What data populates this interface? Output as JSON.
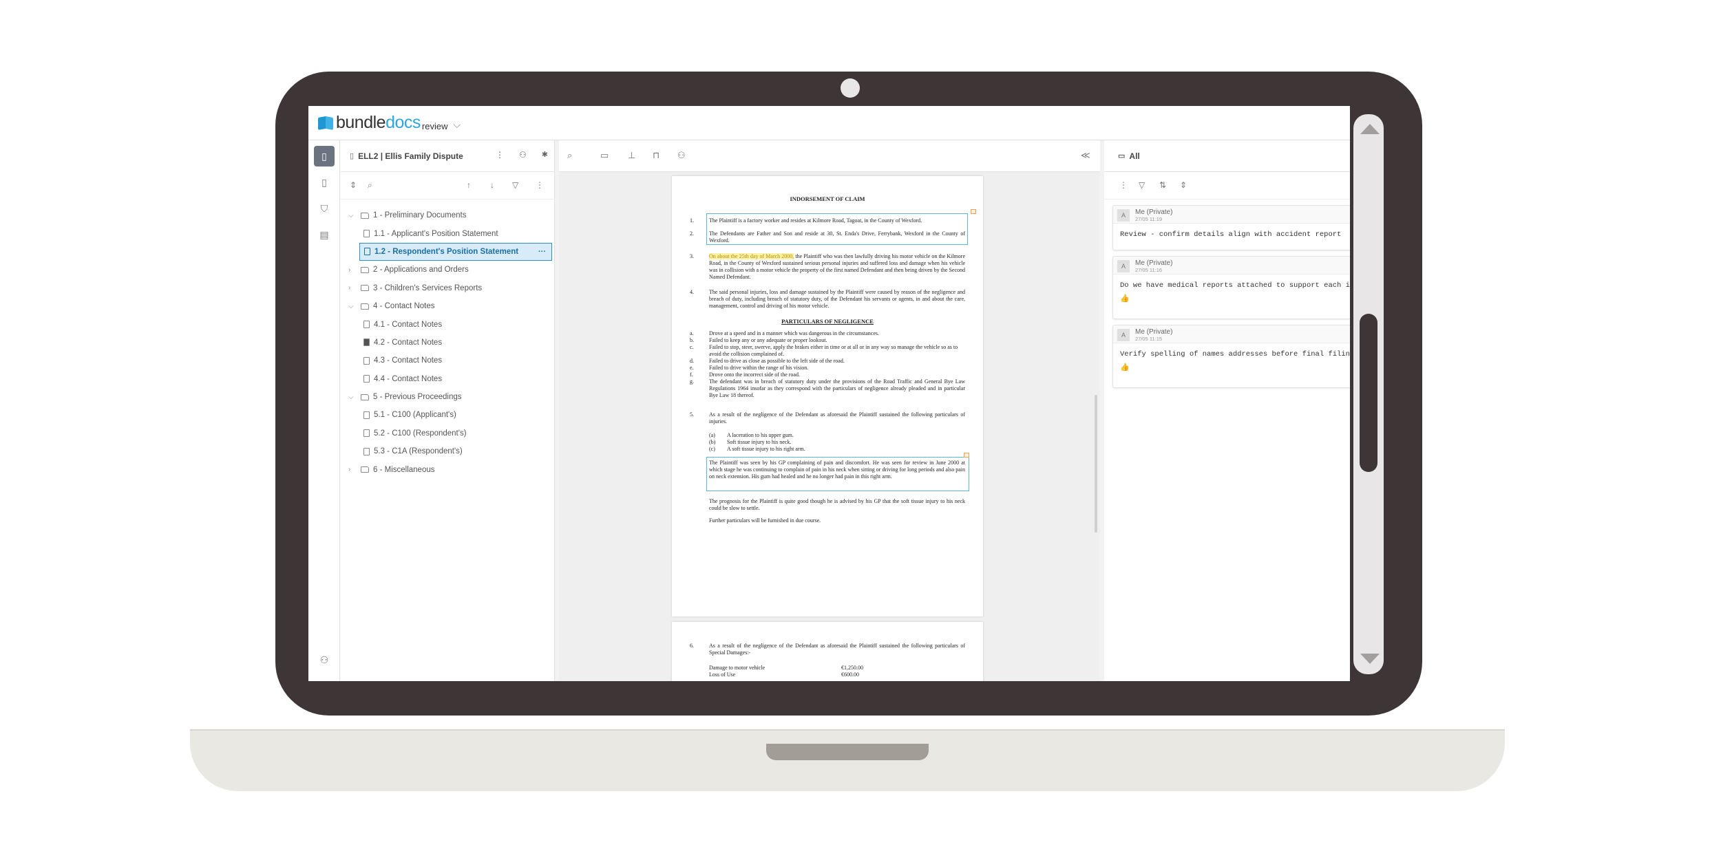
{
  "app": {
    "logo_bundle": "bundle",
    "logo_docs": "docs",
    "logo_review": "review"
  },
  "tree": {
    "title": "ELL2 | Ellis Family Dispute",
    "items": [
      {
        "label": "1 - Preliminary Documents",
        "type": "folder",
        "chevron": "⌵"
      },
      {
        "label": "1.1 - Applicant's Position Statement",
        "type": "doc"
      },
      {
        "label": "1.2 - Respondent's Position Statement",
        "type": "doc"
      },
      {
        "label": "2 - Applications and Orders",
        "type": "folder",
        "chevron": "›"
      },
      {
        "label": "3 - Children's Services Reports",
        "type": "folder",
        "chevron": "›"
      },
      {
        "label": "4 - Contact Notes",
        "type": "folder",
        "chevron": "⌵"
      },
      {
        "label": "4.1 - Contact Notes",
        "type": "doc"
      },
      {
        "label": "4.2 - Contact Notes",
        "type": "doc"
      },
      {
        "label": "4.3 - Contact Notes",
        "type": "doc"
      },
      {
        "label": "4.4 - Contact Notes",
        "type": "doc"
      },
      {
        "label": "5 - Previous Proceedings",
        "type": "folder",
        "chevron": "⌵"
      },
      {
        "label": "5.1 - C100 (Applicant's)",
        "type": "doc"
      },
      {
        "label": "5.2 - C100 (Respondent's)",
        "type": "doc"
      },
      {
        "label": "5.3 - C1A (Respondent's)",
        "type": "doc"
      },
      {
        "label": "6 - Miscellaneous",
        "type": "folder",
        "chevron": "›"
      }
    ],
    "more": "···"
  },
  "document": {
    "heading": "INDORSEMENT OF CLAIM",
    "p1_num": "1.",
    "p1": "The Plaintiff is a factory worker and resides at Kilmore Road, Tagoat, in the County of Wexford.",
    "p2_num": "2.",
    "p2": "The Defendants are Father and Son and reside at 30, St. Enda's Drive, Ferrybank, Wexford in the County of Wexford.",
    "p3_num": "3.",
    "p3_highlight": "On about the 25th day of March 2000,",
    "p3": " the Plaintiff who was then lawfully driving his motor vehicle on the Kilmore Road, in the County of Wexford sustained serious personal injuries and suffered loss and damage when his vehicle was in collision with a motor vehicle the property of the first named Defendant and then being driven by the Second Named Defendant.",
    "p4_num": "4.",
    "p4": "The said personal injuries, loss and damage sustained by the Plaintiff were caused by reason of the negligence and breach of duty, including breach of statutory duty, of the Defendant his servants or agents, in and about the care, management, control and driving of his motor vehicle.",
    "heading2": "PARTICULARS OF NEGLIGENCE",
    "neg_items": [
      {
        "k": "a.",
        "t": "Drove at a speed and in a manner which was dangerous in the circumstances."
      },
      {
        "k": "b.",
        "t": "Failed to keep any or any adequate or proper lookout."
      },
      {
        "k": "c.",
        "t": "Failed to stop, steer, swerve, apply the brakes either in time or at all or in any way so manage the vehicle so as to avoid the collision complained of."
      },
      {
        "k": "d.",
        "t": "Failed to drive as close as possible to the left side of the road."
      },
      {
        "k": "e.",
        "t": "Failed to drive within the range of his vision."
      },
      {
        "k": "f.",
        "t": "Drove onto the incorrect side of the road."
      },
      {
        "k": "g.",
        "t": "The defendant was in breach of statutory duty under the provisions of the Road Traffic and General Bye Law Regulations 1964 insofar as they correspond with the particulars of negligence already pleaded and in particular Bye Law 18 thereof."
      }
    ],
    "p5_num": "5.",
    "p5": "As a result of the negligence of the Defendant as aforesaid the Plaintiff sustained the following particulars of injuries.",
    "inj_items": [
      {
        "k": "(a)",
        "t": "A laceration to his upper gum."
      },
      {
        "k": "(b)",
        "t": "Soft tissue injury to his neck."
      },
      {
        "k": "(c)",
        "t": "A soft tissue injury to his right arm."
      }
    ],
    "p6": "The Plaintiff was seen by his GP complaining of pain and discomfort. He was seen for review in June 2000 at which stage he was continuing to complain of pain in his neck when sitting or driving for long periods and also pain on neck extension. His gum had healed and he no longer had pain in this right arm.",
    "p7": "The prognosis for the Plaintiff is quite good though he is advised by his GP that the soft tissue injury to his neck could be slow to settle.",
    "p8": "Further particulars will be furnished in due course.",
    "page2_num": "6.",
    "page2_p": "As a result of the negligence of the Defendant as aforesaid the Plaintiff sustained the following particulars of Special Damages:-",
    "dmg1_label": "Damage to motor vehicle",
    "dmg1_value": "€1,250.00",
    "dmg2_label": "Loss of Use",
    "dmg2_value": "€600.00"
  },
  "comments": {
    "filter_label": "All",
    "items": [
      {
        "avatar": "A",
        "author": "Me (Private)",
        "stamp": "27/05 11:19",
        "text": "Review - confirm details align with accident report"
      },
      {
        "avatar": "A",
        "author": "Me (Private)",
        "stamp": "27/05 11:16",
        "text": "Do we have medical reports attached to support each injury?"
      },
      {
        "avatar": "A",
        "author": "Me (Private)",
        "stamp": "27/05 11:15",
        "text": "Verify spelling of names addresses before final filing"
      }
    ]
  },
  "icons": {
    "thumb": "👍",
    "more": "⋮",
    "add_user": "⚇",
    "pin": "📌",
    "search": "⌕",
    "up": "↑",
    "down": "↓",
    "filter": "▽",
    "expand": "⇕",
    "collapse": "≪",
    "sort": "⇅"
  }
}
